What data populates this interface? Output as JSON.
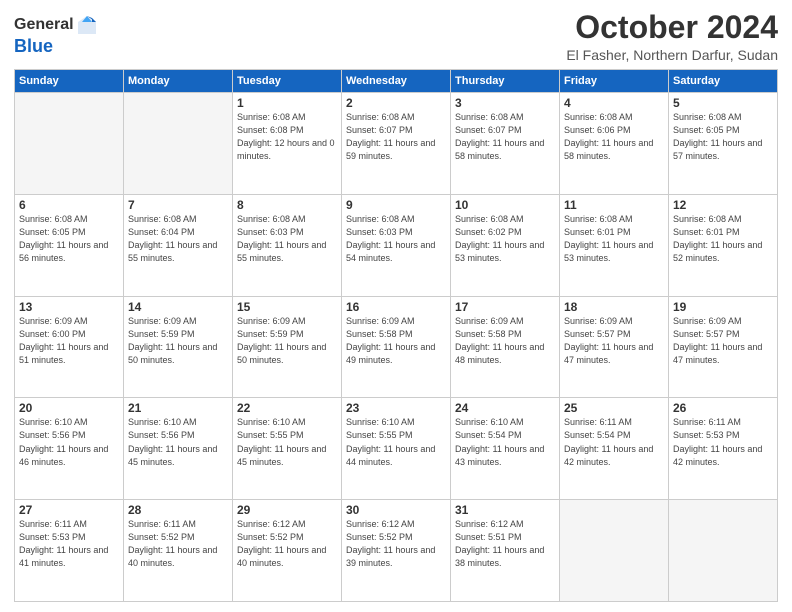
{
  "header": {
    "logo_general": "General",
    "logo_blue": "Blue",
    "month_title": "October 2024",
    "location": "El Fasher, Northern Darfur, Sudan"
  },
  "weekdays": [
    "Sunday",
    "Monday",
    "Tuesday",
    "Wednesday",
    "Thursday",
    "Friday",
    "Saturday"
  ],
  "weeks": [
    [
      {
        "day": "",
        "sunrise": "",
        "sunset": "",
        "daylight": ""
      },
      {
        "day": "",
        "sunrise": "",
        "sunset": "",
        "daylight": ""
      },
      {
        "day": "1",
        "sunrise": "Sunrise: 6:08 AM",
        "sunset": "Sunset: 6:08 PM",
        "daylight": "Daylight: 12 hours and 0 minutes."
      },
      {
        "day": "2",
        "sunrise": "Sunrise: 6:08 AM",
        "sunset": "Sunset: 6:07 PM",
        "daylight": "Daylight: 11 hours and 59 minutes."
      },
      {
        "day": "3",
        "sunrise": "Sunrise: 6:08 AM",
        "sunset": "Sunset: 6:07 PM",
        "daylight": "Daylight: 11 hours and 58 minutes."
      },
      {
        "day": "4",
        "sunrise": "Sunrise: 6:08 AM",
        "sunset": "Sunset: 6:06 PM",
        "daylight": "Daylight: 11 hours and 58 minutes."
      },
      {
        "day": "5",
        "sunrise": "Sunrise: 6:08 AM",
        "sunset": "Sunset: 6:05 PM",
        "daylight": "Daylight: 11 hours and 57 minutes."
      }
    ],
    [
      {
        "day": "6",
        "sunrise": "Sunrise: 6:08 AM",
        "sunset": "Sunset: 6:05 PM",
        "daylight": "Daylight: 11 hours and 56 minutes."
      },
      {
        "day": "7",
        "sunrise": "Sunrise: 6:08 AM",
        "sunset": "Sunset: 6:04 PM",
        "daylight": "Daylight: 11 hours and 55 minutes."
      },
      {
        "day": "8",
        "sunrise": "Sunrise: 6:08 AM",
        "sunset": "Sunset: 6:03 PM",
        "daylight": "Daylight: 11 hours and 55 minutes."
      },
      {
        "day": "9",
        "sunrise": "Sunrise: 6:08 AM",
        "sunset": "Sunset: 6:03 PM",
        "daylight": "Daylight: 11 hours and 54 minutes."
      },
      {
        "day": "10",
        "sunrise": "Sunrise: 6:08 AM",
        "sunset": "Sunset: 6:02 PM",
        "daylight": "Daylight: 11 hours and 53 minutes."
      },
      {
        "day": "11",
        "sunrise": "Sunrise: 6:08 AM",
        "sunset": "Sunset: 6:01 PM",
        "daylight": "Daylight: 11 hours and 53 minutes."
      },
      {
        "day": "12",
        "sunrise": "Sunrise: 6:08 AM",
        "sunset": "Sunset: 6:01 PM",
        "daylight": "Daylight: 11 hours and 52 minutes."
      }
    ],
    [
      {
        "day": "13",
        "sunrise": "Sunrise: 6:09 AM",
        "sunset": "Sunset: 6:00 PM",
        "daylight": "Daylight: 11 hours and 51 minutes."
      },
      {
        "day": "14",
        "sunrise": "Sunrise: 6:09 AM",
        "sunset": "Sunset: 5:59 PM",
        "daylight": "Daylight: 11 hours and 50 minutes."
      },
      {
        "day": "15",
        "sunrise": "Sunrise: 6:09 AM",
        "sunset": "Sunset: 5:59 PM",
        "daylight": "Daylight: 11 hours and 50 minutes."
      },
      {
        "day": "16",
        "sunrise": "Sunrise: 6:09 AM",
        "sunset": "Sunset: 5:58 PM",
        "daylight": "Daylight: 11 hours and 49 minutes."
      },
      {
        "day": "17",
        "sunrise": "Sunrise: 6:09 AM",
        "sunset": "Sunset: 5:58 PM",
        "daylight": "Daylight: 11 hours and 48 minutes."
      },
      {
        "day": "18",
        "sunrise": "Sunrise: 6:09 AM",
        "sunset": "Sunset: 5:57 PM",
        "daylight": "Daylight: 11 hours and 47 minutes."
      },
      {
        "day": "19",
        "sunrise": "Sunrise: 6:09 AM",
        "sunset": "Sunset: 5:57 PM",
        "daylight": "Daylight: 11 hours and 47 minutes."
      }
    ],
    [
      {
        "day": "20",
        "sunrise": "Sunrise: 6:10 AM",
        "sunset": "Sunset: 5:56 PM",
        "daylight": "Daylight: 11 hours and 46 minutes."
      },
      {
        "day": "21",
        "sunrise": "Sunrise: 6:10 AM",
        "sunset": "Sunset: 5:56 PM",
        "daylight": "Daylight: 11 hours and 45 minutes."
      },
      {
        "day": "22",
        "sunrise": "Sunrise: 6:10 AM",
        "sunset": "Sunset: 5:55 PM",
        "daylight": "Daylight: 11 hours and 45 minutes."
      },
      {
        "day": "23",
        "sunrise": "Sunrise: 6:10 AM",
        "sunset": "Sunset: 5:55 PM",
        "daylight": "Daylight: 11 hours and 44 minutes."
      },
      {
        "day": "24",
        "sunrise": "Sunrise: 6:10 AM",
        "sunset": "Sunset: 5:54 PM",
        "daylight": "Daylight: 11 hours and 43 minutes."
      },
      {
        "day": "25",
        "sunrise": "Sunrise: 6:11 AM",
        "sunset": "Sunset: 5:54 PM",
        "daylight": "Daylight: 11 hours and 42 minutes."
      },
      {
        "day": "26",
        "sunrise": "Sunrise: 6:11 AM",
        "sunset": "Sunset: 5:53 PM",
        "daylight": "Daylight: 11 hours and 42 minutes."
      }
    ],
    [
      {
        "day": "27",
        "sunrise": "Sunrise: 6:11 AM",
        "sunset": "Sunset: 5:53 PM",
        "daylight": "Daylight: 11 hours and 41 minutes."
      },
      {
        "day": "28",
        "sunrise": "Sunrise: 6:11 AM",
        "sunset": "Sunset: 5:52 PM",
        "daylight": "Daylight: 11 hours and 40 minutes."
      },
      {
        "day": "29",
        "sunrise": "Sunrise: 6:12 AM",
        "sunset": "Sunset: 5:52 PM",
        "daylight": "Daylight: 11 hours and 40 minutes."
      },
      {
        "day": "30",
        "sunrise": "Sunrise: 6:12 AM",
        "sunset": "Sunset: 5:52 PM",
        "daylight": "Daylight: 11 hours and 39 minutes."
      },
      {
        "day": "31",
        "sunrise": "Sunrise: 6:12 AM",
        "sunset": "Sunset: 5:51 PM",
        "daylight": "Daylight: 11 hours and 38 minutes."
      },
      {
        "day": "",
        "sunrise": "",
        "sunset": "",
        "daylight": ""
      },
      {
        "day": "",
        "sunrise": "",
        "sunset": "",
        "daylight": ""
      }
    ]
  ]
}
